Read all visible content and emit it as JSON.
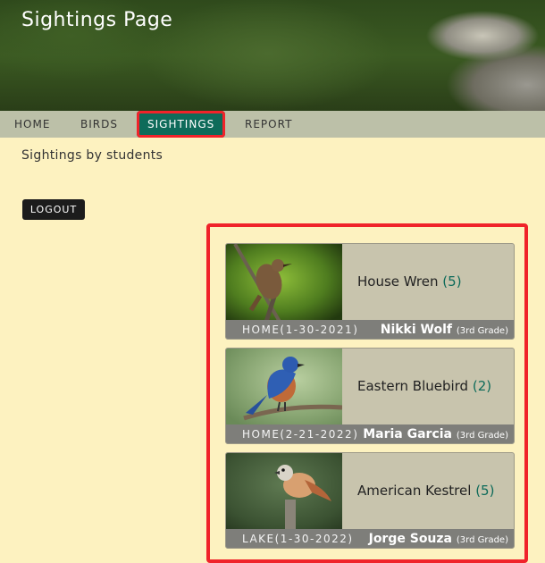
{
  "header": {
    "title": "Sightings Page"
  },
  "nav": {
    "items": [
      {
        "label": "HOME"
      },
      {
        "label": "BIRDS"
      },
      {
        "label": "SIGHTINGS"
      },
      {
        "label": "REPORT"
      }
    ]
  },
  "subtitle": "Sightings by students",
  "logout_label": "LOGOUT",
  "sightings": [
    {
      "bird": "House Wren",
      "count": "(5)",
      "location": "HOME(1-30-2021)",
      "student": "Nikki Wolf",
      "grade": "(3rd Grade)"
    },
    {
      "bird": "Eastern Bluebird",
      "count": "(2)",
      "location": "HOME(2-21-2022)",
      "student": "Maria Garcia",
      "grade": "(3rd Grade)"
    },
    {
      "bird": "American Kestrel",
      "count": "(5)",
      "location": "LAKE(1-30-2022)",
      "student": "Jorge Souza",
      "grade": "(3rd Grade)"
    }
  ],
  "colors": {
    "accent": "#0e6b5a",
    "highlight": "#f0232a",
    "background": "#fdf2c0"
  }
}
